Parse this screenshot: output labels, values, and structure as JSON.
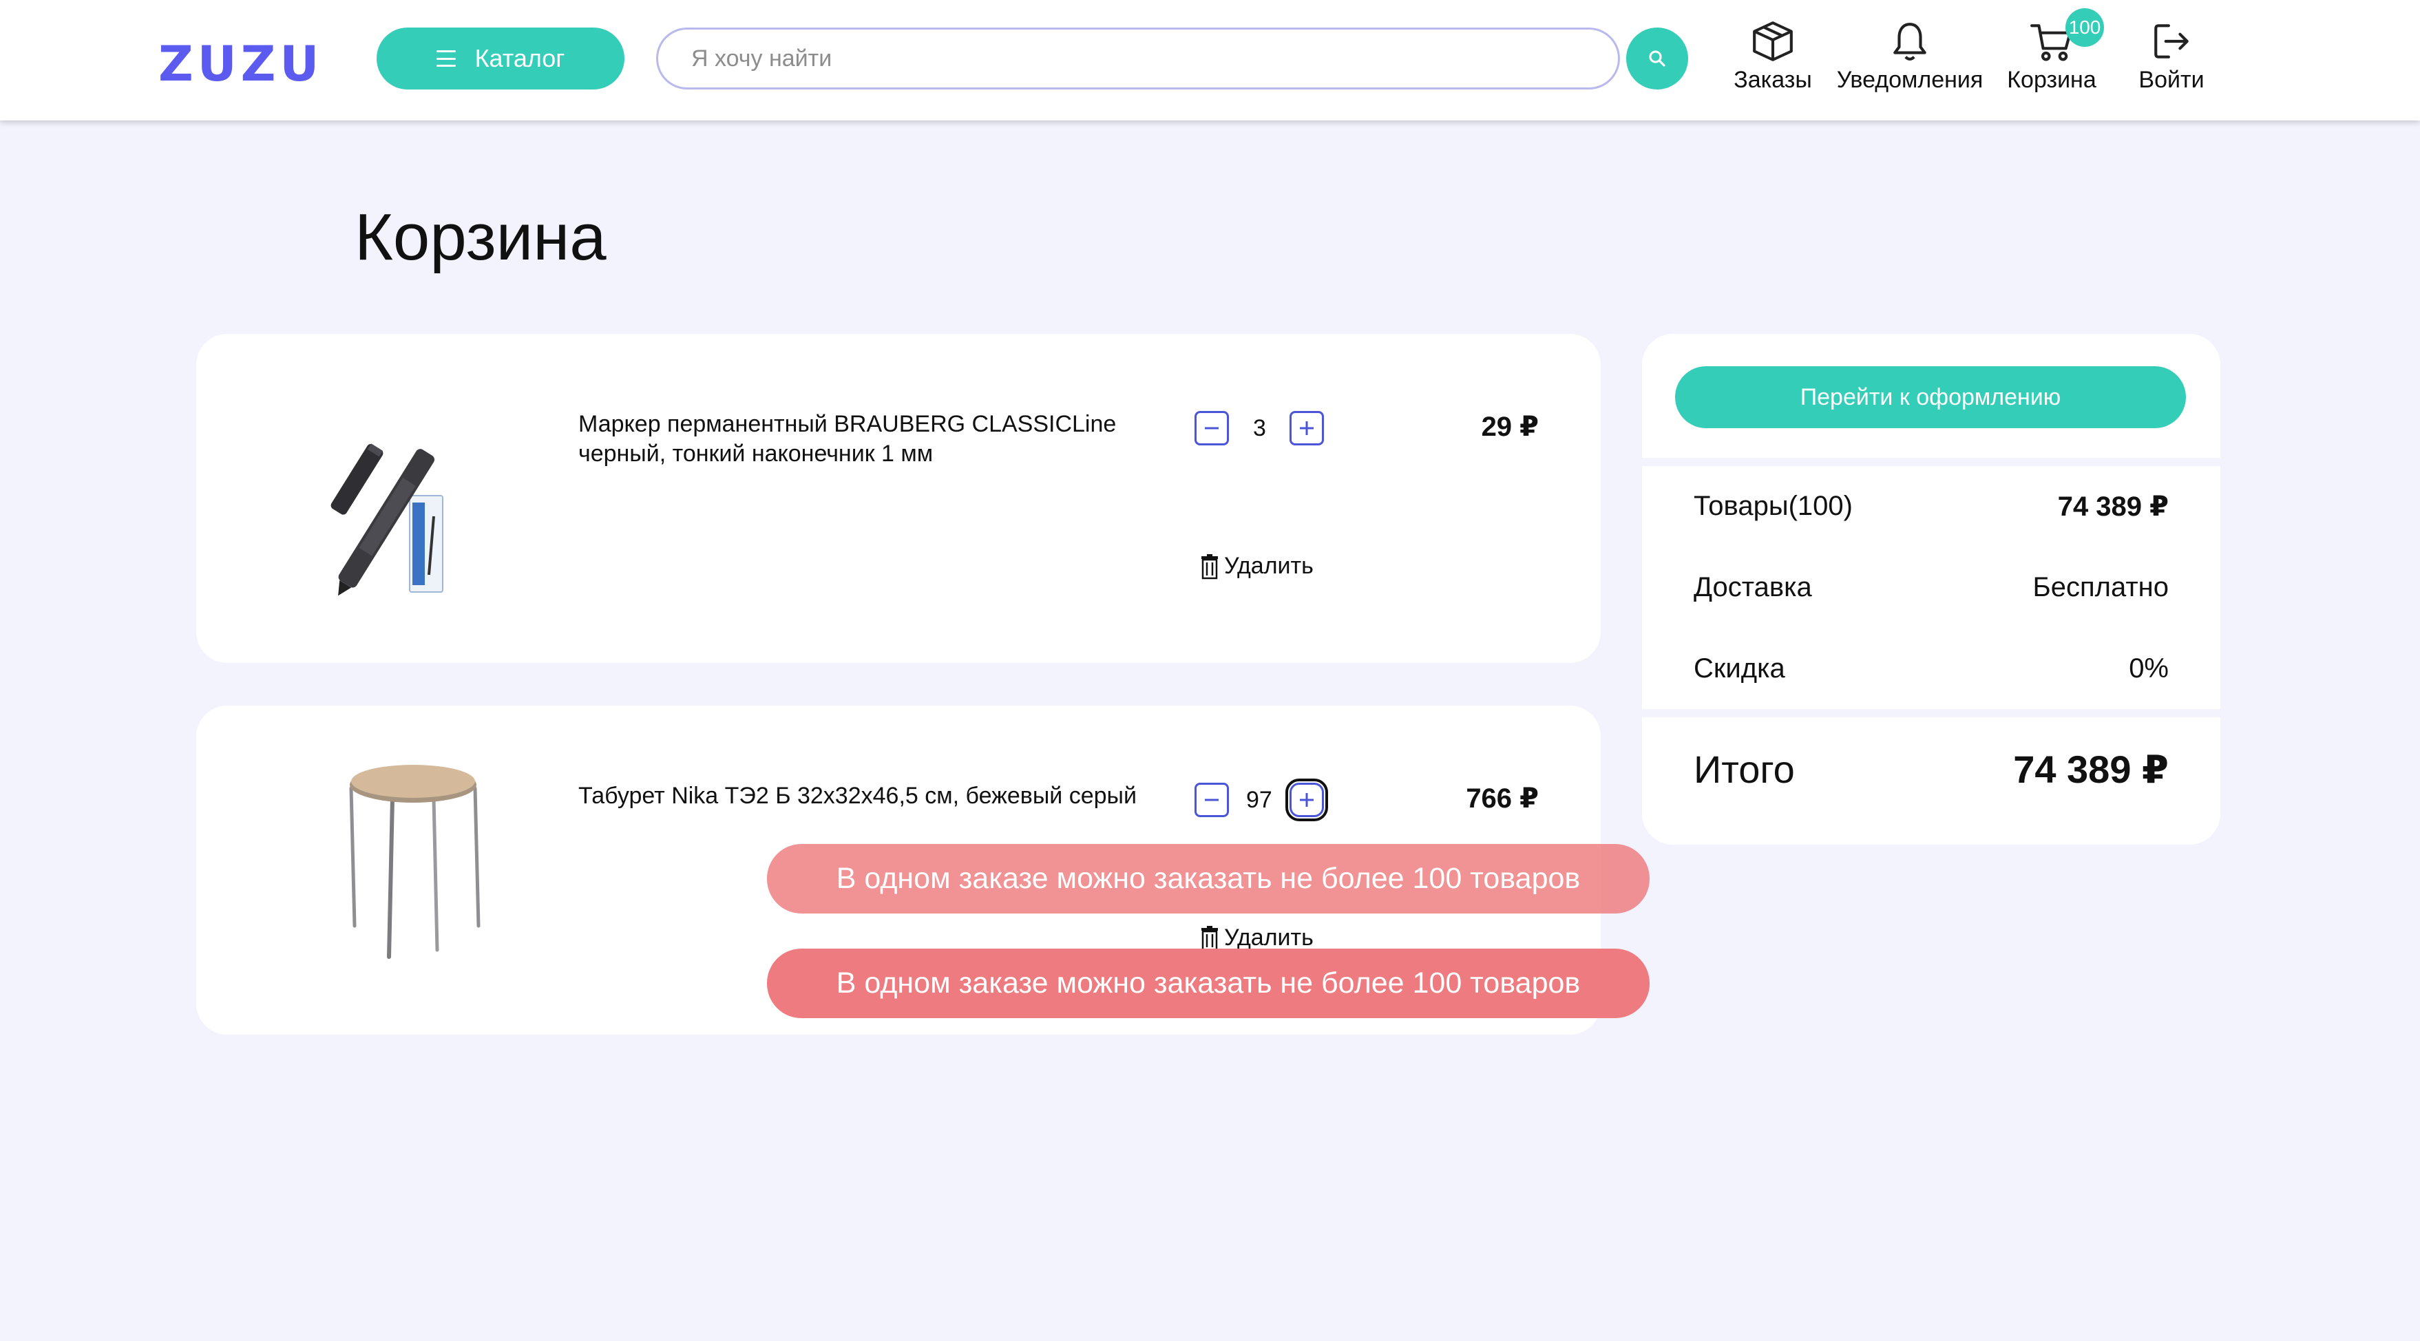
{
  "header": {
    "logo": "ZUZU",
    "catalog_label": "Каталог",
    "search_placeholder": "Я хочу найти",
    "nav": {
      "orders": "Заказы",
      "notifications": "Уведомления",
      "cart": "Корзина",
      "login": "Войти"
    },
    "cart_badge": "100"
  },
  "page": {
    "title": "Корзина"
  },
  "cart": {
    "items": [
      {
        "name": "Маркер перманентный BRAUBERG CLASSICLine черный, тонкий наконечник 1 мм",
        "quantity": "3",
        "price": "29 ₽",
        "remove_label": "Удалить",
        "image_icon": "marker-product-image"
      },
      {
        "name": "Табурет Nika ТЭ2 Б 32х32х46,5 см, бежевый серый",
        "quantity": "97",
        "price": "766 ₽",
        "remove_label": "Удалить",
        "image_icon": "stool-product-image"
      }
    ]
  },
  "summary": {
    "checkout_label": "Перейти к оформлению",
    "goods_label": "Товары(100)",
    "goods_value": "74 389 ₽",
    "delivery_label": "Доставка",
    "delivery_value": "Бесплатно",
    "discount_label": "Скидка",
    "discount_value": "0%",
    "total_label": "Итого",
    "total_value": "74 389 ₽"
  },
  "toasts": [
    "В одном заказе можно заказать не более 100 товаров",
    "В одном заказе можно заказать не более 100 товаров"
  ],
  "colors": {
    "accent": "#34cdb8",
    "brand": "#5b5bf0",
    "background": "#f3f3fe",
    "toast": "#ee7b7f",
    "qty_border": "#4b55d8"
  }
}
